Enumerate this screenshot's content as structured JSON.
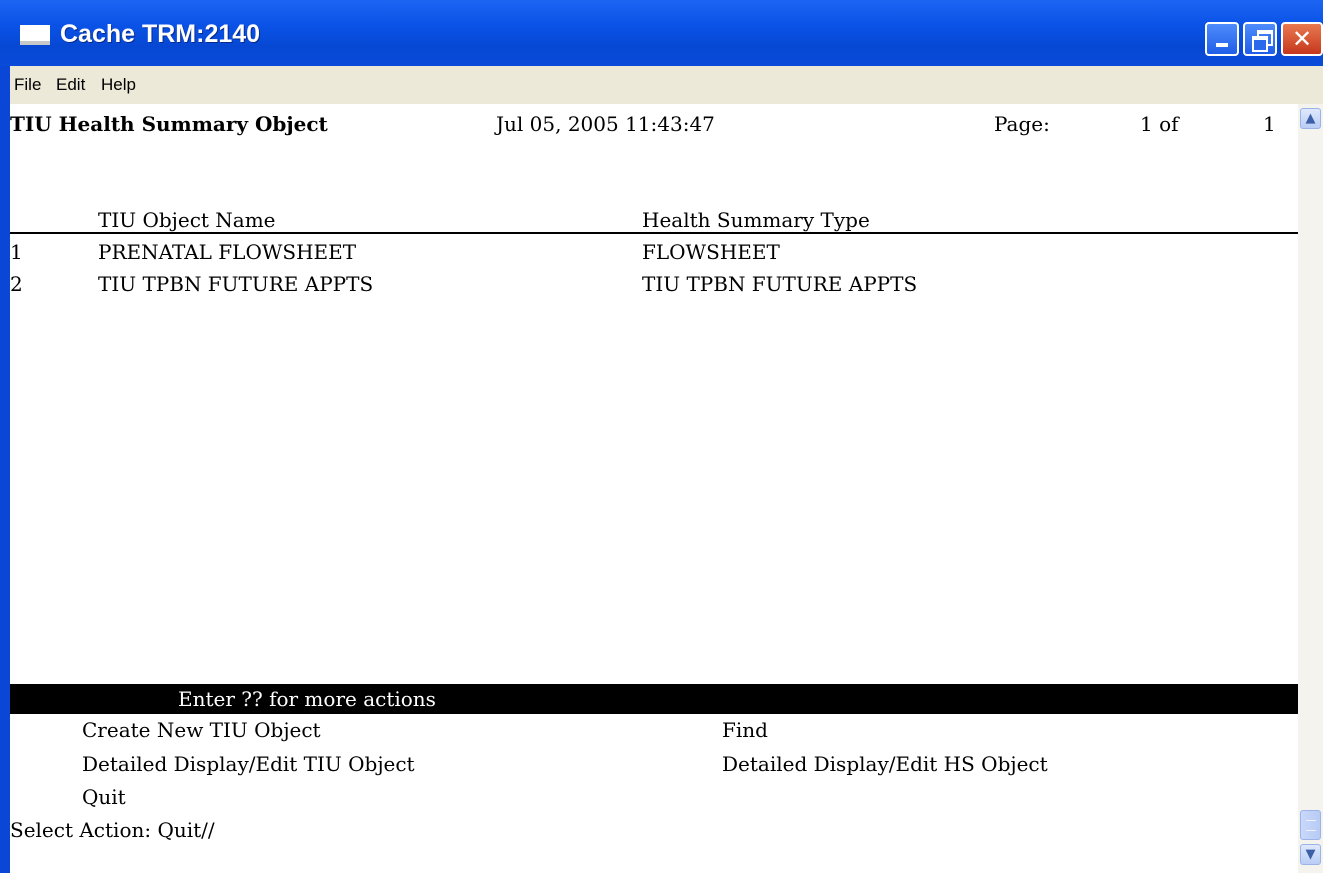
{
  "window": {
    "title": "Cache TRM:2140",
    "controls": {
      "minimize": "minimize",
      "maximize": "maximize",
      "close": "✕"
    }
  },
  "menu": [
    "File",
    "Edit",
    "Help"
  ],
  "header": {
    "title": "TIU Health Summary Object",
    "datetime": "Jul 05, 2005 11:43:47",
    "page_label": "Page:",
    "page_current": "1 of",
    "page_total": "1"
  },
  "table": {
    "columns": [
      "TIU Object Name",
      "Health Summary Type"
    ],
    "rows": [
      {
        "num": "1",
        "name": "PRENATAL FLOWSHEET",
        "type": "FLOWSHEET"
      },
      {
        "num": "2",
        "name": "TIU TPBN FUTURE APPTS",
        "type": "TIU TPBN FUTURE APPTS"
      }
    ]
  },
  "banner": "Enter ?? for more actions",
  "actions": {
    "create": "Create New TIU Object",
    "find": "Find",
    "detail_tiu": "Detailed Display/Edit TIU Object",
    "detail_hs": "Detailed Display/Edit HS Object",
    "quit": "Quit"
  },
  "prompt": "Select Action: Quit//",
  "colors": {
    "titlebar": "#0a52e6",
    "terminal_bg": "#ffffff",
    "banner_bg": "#000000"
  }
}
